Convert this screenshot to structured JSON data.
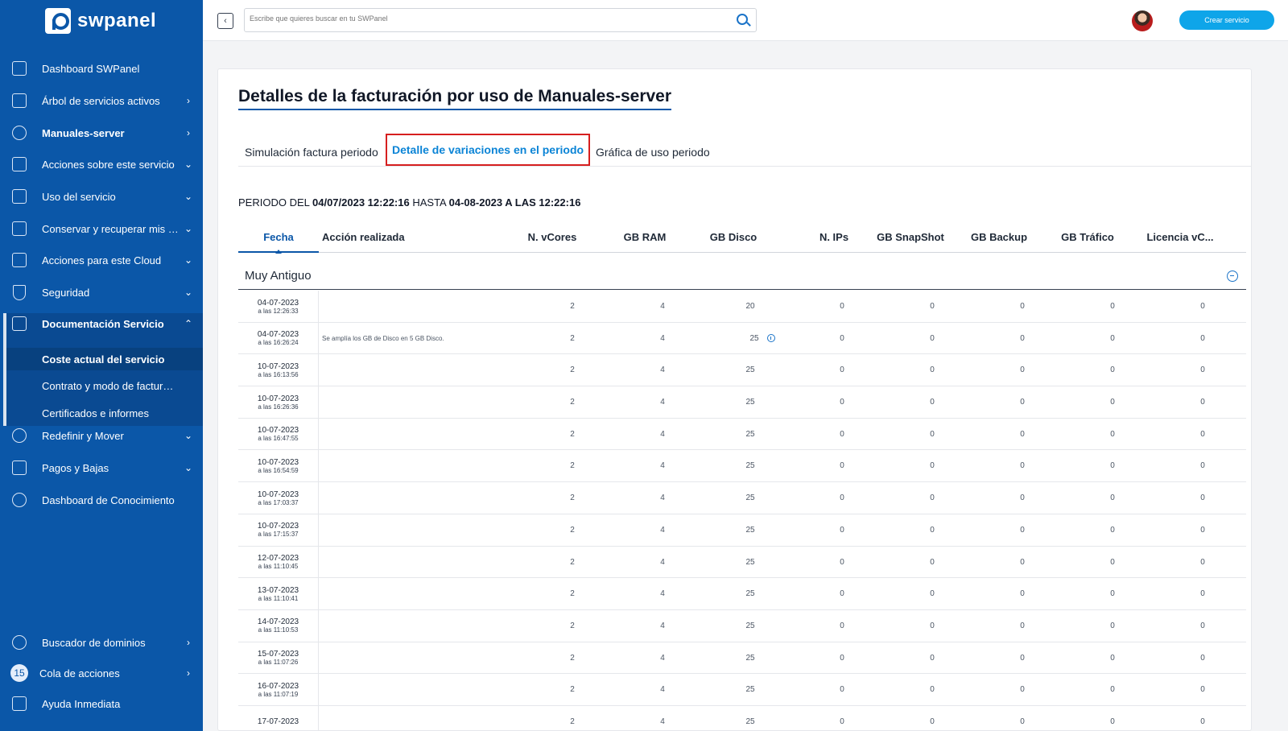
{
  "brand": {
    "name": "swpanel"
  },
  "sidebar": {
    "items": [
      {
        "label": "Dashboard SWPanel",
        "icon": "dashboard-grid-icon",
        "arrow": ""
      },
      {
        "label": "Árbol de servicios activos",
        "icon": "tree-icon",
        "arrow": "›"
      },
      {
        "label": "Manuales-server",
        "icon": "server-circle-icon",
        "arrow": "›",
        "bold": true
      },
      {
        "label": "Acciones sobre este servicio",
        "icon": "server-actions-icon",
        "arrow": "⌄"
      },
      {
        "label": "Uso del servicio",
        "icon": "chart-icon",
        "arrow": "⌄"
      },
      {
        "label": "Conservar y recuperar mis datos",
        "icon": "archive-icon",
        "arrow": "⌄"
      },
      {
        "label": "Acciones para este Cloud",
        "icon": "tools-icon",
        "arrow": "⌄"
      },
      {
        "label": "Seguridad",
        "icon": "shield-icon",
        "arrow": "⌄"
      },
      {
        "label": "Documentación Servicio",
        "icon": "document-icon",
        "arrow": "⌃",
        "bold": true
      },
      {
        "label": "Redefinir y Mover",
        "icon": "refresh-icon",
        "arrow": "⌄"
      },
      {
        "label": "Pagos y Bajas",
        "icon": "coins-icon",
        "arrow": "⌄"
      },
      {
        "label": "Dashboard de Conocimiento",
        "icon": "help-circle-icon",
        "arrow": ""
      }
    ],
    "sub_items": [
      {
        "label": "Coste actual del servicio",
        "current": true
      },
      {
        "label": "Contrato y modo de facturación"
      },
      {
        "label": "Certificados e informes"
      }
    ],
    "bottom_items": [
      {
        "label": "Buscador de dominios",
        "icon": "globe-icon",
        "arrow": "›"
      },
      {
        "label": "Cola de acciones",
        "icon": "queue-badge-icon",
        "badge": "15",
        "arrow": "›"
      },
      {
        "label": "Ayuda Inmediata",
        "icon": "chat-icon",
        "arrow": ""
      }
    ]
  },
  "topbar": {
    "search_placeholder": "Escribe que quieres buscar en tu SWPanel",
    "create_button": "Crear servicio"
  },
  "page": {
    "title": "Detalles de la facturación por uso de Manuales-server",
    "tabs": [
      {
        "label": "Simulación factura periodo"
      },
      {
        "label": "Detalle de variaciones en el periodo",
        "active": true
      },
      {
        "label": "Gráfica de uso periodo"
      }
    ],
    "period": {
      "prefix": "PERIODO DEL",
      "start": "04/07/2023 12:22:16",
      "middle": "HASTA",
      "end": "04-08-2023 A LAS 12:22:16"
    }
  },
  "table": {
    "columns": [
      "Fecha",
      "Acción realizada",
      "N. vCores",
      "GB RAM",
      "GB Disco",
      "N. IPs",
      "GB SnapShot",
      "GB Backup",
      "GB Tráfico",
      "Licencia vC..."
    ],
    "group_title": "Muy Antiguo",
    "rows": [
      {
        "date": "04-07-2023",
        "time": "a las 12:26:33",
        "action": "",
        "vcores": "2",
        "ram": "4",
        "disk": "20",
        "ips": "0",
        "snapshot": "0",
        "backup": "0",
        "traffic": "0",
        "license": "0"
      },
      {
        "date": "04-07-2023",
        "time": "a las 16:26:24",
        "action": "Se amplía los GB de Disco en 5 GB Disco.",
        "vcores": "2",
        "ram": "4",
        "disk": "25",
        "disk_info": true,
        "ips": "0",
        "snapshot": "0",
        "backup": "0",
        "traffic": "0",
        "license": "0"
      },
      {
        "date": "10-07-2023",
        "time": "a las 16:13:56",
        "action": "",
        "vcores": "2",
        "ram": "4",
        "disk": "25",
        "ips": "0",
        "snapshot": "0",
        "backup": "0",
        "traffic": "0",
        "license": "0"
      },
      {
        "date": "10-07-2023",
        "time": "a las 16:26:36",
        "action": "",
        "vcores": "2",
        "ram": "4",
        "disk": "25",
        "ips": "0",
        "snapshot": "0",
        "backup": "0",
        "traffic": "0",
        "license": "0"
      },
      {
        "date": "10-07-2023",
        "time": "a las 16:47:55",
        "action": "",
        "vcores": "2",
        "ram": "4",
        "disk": "25",
        "ips": "0",
        "snapshot": "0",
        "backup": "0",
        "traffic": "0",
        "license": "0"
      },
      {
        "date": "10-07-2023",
        "time": "a las 16:54:59",
        "action": "",
        "vcores": "2",
        "ram": "4",
        "disk": "25",
        "ips": "0",
        "snapshot": "0",
        "backup": "0",
        "traffic": "0",
        "license": "0"
      },
      {
        "date": "10-07-2023",
        "time": "a las 17:03:37",
        "action": "",
        "vcores": "2",
        "ram": "4",
        "disk": "25",
        "ips": "0",
        "snapshot": "0",
        "backup": "0",
        "traffic": "0",
        "license": "0"
      },
      {
        "date": "10-07-2023",
        "time": "a las 17:15:37",
        "action": "",
        "vcores": "2",
        "ram": "4",
        "disk": "25",
        "ips": "0",
        "snapshot": "0",
        "backup": "0",
        "traffic": "0",
        "license": "0"
      },
      {
        "date": "12-07-2023",
        "time": "a las 11:10:45",
        "action": "",
        "vcores": "2",
        "ram": "4",
        "disk": "25",
        "ips": "0",
        "snapshot": "0",
        "backup": "0",
        "traffic": "0",
        "license": "0"
      },
      {
        "date": "13-07-2023",
        "time": "a las 11:10:41",
        "action": "",
        "vcores": "2",
        "ram": "4",
        "disk": "25",
        "ips": "0",
        "snapshot": "0",
        "backup": "0",
        "traffic": "0",
        "license": "0"
      },
      {
        "date": "14-07-2023",
        "time": "a las 11:10:53",
        "action": "",
        "vcores": "2",
        "ram": "4",
        "disk": "25",
        "ips": "0",
        "snapshot": "0",
        "backup": "0",
        "traffic": "0",
        "license": "0"
      },
      {
        "date": "15-07-2023",
        "time": "a las 11:07:26",
        "action": "",
        "vcores": "2",
        "ram": "4",
        "disk": "25",
        "ips": "0",
        "snapshot": "0",
        "backup": "0",
        "traffic": "0",
        "license": "0"
      },
      {
        "date": "16-07-2023",
        "time": "a las 11:07:19",
        "action": "",
        "vcores": "2",
        "ram": "4",
        "disk": "25",
        "ips": "0",
        "snapshot": "0",
        "backup": "0",
        "traffic": "0",
        "license": "0"
      },
      {
        "date": "17-07-2023",
        "time": "",
        "action": "",
        "vcores": "2",
        "ram": "4",
        "disk": "25",
        "ips": "0",
        "snapshot": "0",
        "backup": "0",
        "traffic": "0",
        "license": "0"
      }
    ]
  },
  "colors": {
    "sidebar": "#0b57a8",
    "accent": "#0b84d6",
    "highlight": "#d61f1f",
    "button": "#0ea5e9"
  }
}
